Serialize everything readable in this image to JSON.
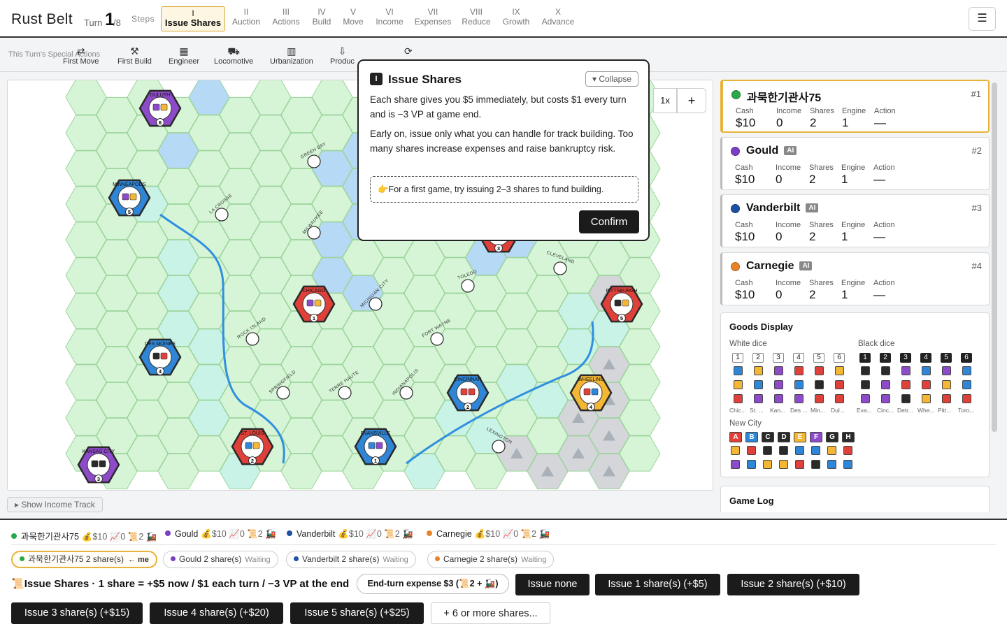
{
  "header": {
    "app_title": "Rust Belt",
    "turn_label": "Turn",
    "turn_current": "1",
    "turn_total": "/8",
    "steps_label": "Steps",
    "steps": [
      {
        "roman": "I",
        "label": "Issue Shares",
        "active": true
      },
      {
        "roman": "II",
        "label": "Auction"
      },
      {
        "roman": "III",
        "label": "Actions"
      },
      {
        "roman": "IV",
        "label": "Build"
      },
      {
        "roman": "V",
        "label": "Move"
      },
      {
        "roman": "VI",
        "label": "Income"
      },
      {
        "roman": "VII",
        "label": "Expenses"
      },
      {
        "roman": "VIII",
        "label": "Reduce"
      },
      {
        "roman": "IX",
        "label": "Growth"
      },
      {
        "roman": "X",
        "label": "Advance"
      }
    ],
    "menu_icon": "hamburger-icon"
  },
  "special_actions": {
    "label": "This Turn's Special Actions",
    "items": [
      {
        "label": "First Move",
        "icon": "⇄"
      },
      {
        "label": "First Build",
        "icon": "⚒"
      },
      {
        "label": "Engineer",
        "icon": "▦"
      },
      {
        "label": "Locomotive",
        "icon": "⛟"
      },
      {
        "label": "Urbanization",
        "icon": "▥"
      },
      {
        "label": "Produc",
        "icon": "⇩"
      },
      {
        "label": "",
        "icon": "⟳"
      }
    ]
  },
  "board": {
    "zoom_label": "1x",
    "zoom_in": "+",
    "show_income_track": "▸ Show Income Track",
    "cities": [
      {
        "name": "DULUTH",
        "color": "purple",
        "n": "6"
      },
      {
        "name": "MINNEAPOLIS",
        "color": "blue",
        "n": "5"
      },
      {
        "name": "CHICAGO",
        "color": "red",
        "n": "1"
      },
      {
        "name": "DES MOINES",
        "color": "blue",
        "n": "4"
      },
      {
        "name": "ST. LOUIS",
        "color": "red",
        "n": "2"
      },
      {
        "name": "EVANSVILLE",
        "color": "blue",
        "n": "1"
      },
      {
        "name": "CINCINNATI",
        "color": "blue",
        "n": "2"
      },
      {
        "name": "WHEELING",
        "color": "yellow",
        "n": "4"
      },
      {
        "name": "PITTSBURGH",
        "color": "red",
        "n": "5"
      },
      {
        "name": "KANSAS CITY",
        "color": "purple",
        "n": "3"
      },
      {
        "name": "",
        "color": "red",
        "n": "3"
      }
    ],
    "towns": [
      "GREEN BAY",
      "LA CROSSE",
      "MILWAUKEE",
      "MICHIGAN CITY",
      "TOLEDO",
      "CLEVELAND",
      "ROCK ISLAND",
      "FORT WAYNE",
      "SPRINGFIELD",
      "TERRE HAUTE",
      "INDIANAPOLIS",
      "LEXINGTON"
    ]
  },
  "popup": {
    "icon": "I",
    "title": "Issue Shares",
    "collapse_label": "▾ Collapse",
    "para1": "Each share gives you $5 immediately, but costs $1 every turn and is −3 VP at game end.",
    "para2": "Early on, issue only what you can handle for track building. Too many shares increase expenses and raise bankruptcy risk.",
    "tip": "👉For a first game, try issuing 2–3 shares to fund building.",
    "confirm_label": "Confirm"
  },
  "players": [
    {
      "name": "과묵한기관사75",
      "color": "#2aa84a",
      "ai": false,
      "rank": "#1",
      "cash": "$10",
      "income": "0",
      "shares": "2",
      "engine": "1",
      "action": "—",
      "me": true
    },
    {
      "name": "Gould",
      "color": "#7b3fc4",
      "ai": true,
      "rank": "#2",
      "cash": "$10",
      "income": "0",
      "shares": "2",
      "engine": "1",
      "action": "—"
    },
    {
      "name": "Vanderbilt",
      "color": "#1f4fa0",
      "ai": true,
      "rank": "#3",
      "cash": "$10",
      "income": "0",
      "shares": "2",
      "engine": "1",
      "action": "—"
    },
    {
      "name": "Carnegie",
      "color": "#e8832a",
      "ai": true,
      "rank": "#4",
      "cash": "$10",
      "income": "0",
      "shares": "2",
      "engine": "1",
      "action": "—"
    }
  ],
  "labels": {
    "cash": "Cash",
    "income": "Income",
    "shares": "Shares",
    "engine": "Engine",
    "action": "Action",
    "ai": "AI"
  },
  "goods": {
    "title": "Goods Display",
    "white_label": "White dice",
    "black_label": "Black dice",
    "new_city_label": "New City",
    "dice": [
      "1",
      "2",
      "3",
      "4",
      "5",
      "6"
    ],
    "white_cols": [
      {
        "cap": "Chic...",
        "cubes": [
          "blue",
          "yellow",
          "red"
        ]
      },
      {
        "cap": "St. ...",
        "cubes": [
          "yellow",
          "blue",
          "purple"
        ]
      },
      {
        "cap": "Kan...",
        "cubes": [
          "purple",
          "purple",
          "purple"
        ]
      },
      {
        "cap": "Des ...",
        "cubes": [
          "red",
          "blue",
          "purple"
        ]
      },
      {
        "cap": "Min...",
        "cubes": [
          "red",
          "black",
          "red"
        ]
      },
      {
        "cap": "Dul...",
        "cubes": [
          "yellow",
          "red",
          "red"
        ]
      }
    ],
    "black_cols": [
      {
        "cap": "Eva...",
        "cubes": [
          "black",
          "black",
          "purple"
        ]
      },
      {
        "cap": "Cinc...",
        "cubes": [
          "black",
          "purple",
          "purple"
        ]
      },
      {
        "cap": "Detr...",
        "cubes": [
          "purple",
          "red",
          "black"
        ]
      },
      {
        "cap": "Whe...",
        "cubes": [
          "blue",
          "red",
          "yellow"
        ]
      },
      {
        "cap": "Pitt...",
        "cubes": [
          "purple",
          "yellow",
          "red"
        ]
      },
      {
        "cap": "Toro...",
        "cubes": [
          "blue",
          "blue",
          "red"
        ]
      }
    ],
    "new_city": [
      {
        "letter": "A",
        "color": "red",
        "cubes": [
          "yellow",
          "purple"
        ]
      },
      {
        "letter": "B",
        "color": "blue",
        "cubes": [
          "red",
          "blue"
        ]
      },
      {
        "letter": "C",
        "color": "black",
        "cubes": [
          "black",
          "yellow"
        ]
      },
      {
        "letter": "D",
        "color": "black",
        "cubes": [
          "black",
          "yellow"
        ]
      },
      {
        "letter": "E",
        "color": "yellow",
        "cubes": [
          "blue",
          "red"
        ]
      },
      {
        "letter": "F",
        "color": "purple",
        "cubes": [
          "blue",
          "black"
        ]
      },
      {
        "letter": "G",
        "color": "black",
        "cubes": [
          "yellow",
          "blue"
        ]
      },
      {
        "letter": "H",
        "color": "black",
        "cubes": [
          "red",
          "blue"
        ]
      }
    ],
    "colors": {
      "red": "#e0403a",
      "blue": "#2f86d6",
      "yellow": "#f4b735",
      "purple": "#8e4bc9",
      "black": "#2a2a2a"
    }
  },
  "game_log": {
    "title": "Game Log"
  },
  "bottom": {
    "summary": [
      {
        "name": "과묵한기관사75",
        "color": "#2aa84a",
        "stats": "💰$10 📈0 📜2 🚂"
      },
      {
        "name": "Gould",
        "color": "#7b3fc4",
        "stats": "💰$10 📈0 📜2 🚂"
      },
      {
        "name": "Vanderbilt",
        "color": "#1f4fa0",
        "stats": "💰$10 📈0 📜2 🚂"
      },
      {
        "name": "Carnegie",
        "color": "#e8832a",
        "stats": "💰$10 📈0 📜2 🚂"
      }
    ],
    "chips": [
      {
        "name": "과묵한기관사75 2 share(s)",
        "color": "#2aa84a",
        "tag": "← me",
        "me": true
      },
      {
        "name": "Gould 2 share(s)",
        "color": "#7b3fc4",
        "tag": "Waiting"
      },
      {
        "name": "Vanderbilt 2 share(s)",
        "color": "#1f4fa0",
        "tag": "Waiting"
      },
      {
        "name": "Carnegie 2 share(s)",
        "color": "#e8832a",
        "tag": "Waiting"
      }
    ],
    "issue_title_icon": "📜",
    "issue_title": "Issue Shares · 1 share = +$5 now / $1 each turn / −3 VP at the end",
    "expense_chip": "End-turn expense $3 (📜2 + 🚂)",
    "buttons": [
      "Issue none",
      "Issue 1 share(s) (+$5)",
      "Issue 2 share(s) (+$10)",
      "Issue 3 share(s) (+$15)",
      "Issue 4 share(s) (+$20)",
      "Issue 5 share(s) (+$25)",
      "+ 6 or more shares..."
    ]
  }
}
